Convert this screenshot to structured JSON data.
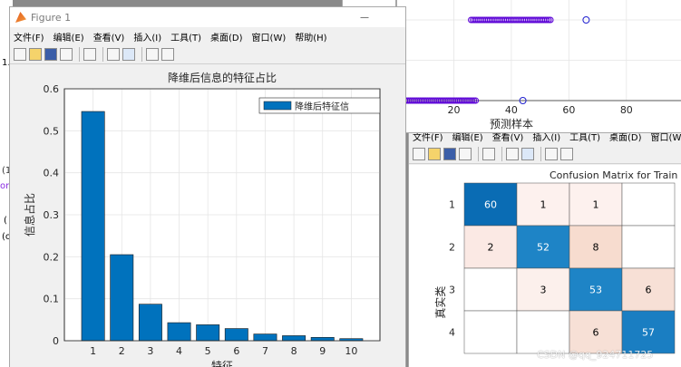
{
  "fig_left": {
    "title": "Figure 1",
    "menu": [
      "文件(F)",
      "编辑(E)",
      "查看(V)",
      "插入(I)",
      "工具(T)",
      "桌面(D)",
      "窗口(W)",
      "帮助(H)"
    ],
    "toolbar_icons": [
      "new-file-icon",
      "open-folder-icon",
      "save-icon",
      "print-icon",
      "print-preview-icon",
      "dock-icon",
      "legend-icon",
      "pointer-icon",
      "property-editor-icon"
    ],
    "minimize_label": "—"
  },
  "fig_top": {
    "xlabel": "预测样本"
  },
  "fig_right": {
    "menu": [
      "文件(F)",
      "编辑(E)",
      "查看(V)",
      "插入(I)",
      "工具(T)",
      "桌面(D)",
      "窗口(W)"
    ],
    "toolbar_icons": [
      "new-file-icon",
      "open-folder-icon",
      "save-icon",
      "print-icon",
      "print-preview-icon",
      "dock-icon",
      "legend-icon",
      "pointer-icon",
      "property-editor-icon"
    ]
  },
  "bg_fragments": {
    "left_one": "1.",
    "left_paren1": "(1",
    "left_or": "or",
    "left_paren2": "(",
    "left_paren3": "(o"
  },
  "watermark": "CSDN @qq_924711725",
  "chart_data": [
    {
      "type": "bar",
      "title": "降维后信息的特征占比",
      "xlabel": "特征",
      "ylabel": "信息占比",
      "categories": [
        "1",
        "2",
        "3",
        "4",
        "5",
        "6",
        "7",
        "8",
        "9",
        "10"
      ],
      "values": [
        0.546,
        0.205,
        0.087,
        0.043,
        0.038,
        0.029,
        0.016,
        0.012,
        0.008,
        0.005
      ],
      "ylim": [
        0,
        0.6
      ],
      "yticks": [
        "0",
        "0.1",
        "0.2",
        "0.3",
        "0.4",
        "0.5",
        "0.6"
      ],
      "legend": "降维后特征信",
      "legend_placement": "top-right",
      "grid": true,
      "color": "#0072BD"
    },
    {
      "type": "scatter",
      "xlabel": "预测样本",
      "xlim": [
        0,
        110
      ],
      "ylim": [
        1,
        2
      ],
      "xticks": [
        "0",
        "20",
        "40",
        "60",
        "80",
        "100"
      ],
      "yticks": [
        "1",
        "1.5",
        "2"
      ],
      "grid": true,
      "series": [
        {
          "marker": "o",
          "color": "#5a00d6",
          "x": [
            0,
            28
          ],
          "y": 1,
          "dense": true
        },
        {
          "marker": "o",
          "color": "#5a00d6",
          "x": [
            26,
            54
          ],
          "y": 2,
          "dense": true
        },
        {
          "marker": "o",
          "color": "#1f1fcf",
          "points": [
            [
              44,
              1
            ],
            [
              66,
              2
            ]
          ]
        }
      ]
    },
    {
      "type": "heatmap",
      "title": "Confusion Matrix for Train D",
      "ylabel": "真实类",
      "row_labels": [
        "1",
        "2",
        "3",
        "4"
      ],
      "cells": [
        [
          "60",
          "1",
          "1",
          ""
        ],
        [
          "2",
          "52",
          "8",
          ""
        ],
        [
          "",
          "3",
          "53",
          "6"
        ],
        [
          "",
          "",
          "6",
          "57"
        ]
      ],
      "colors": [
        [
          "#0a6cb4",
          "#fdf1ee",
          "#fdf1ee",
          "#ffffff"
        ],
        [
          "#fbe9e4",
          "#1e84c6",
          "#f7dccf",
          "#ffffff"
        ],
        [
          "#ffffff",
          "#fcf0ec",
          "#1e84c6",
          "#f7e0d6"
        ],
        [
          "#ffffff",
          "#ffffff",
          "#f7e0d6",
          "#1a7ec2"
        ]
      ],
      "text_colors": [
        [
          "#ffffff",
          "#000000",
          "#000000",
          "#000000"
        ],
        [
          "#000000",
          "#ffffff",
          "#000000",
          "#000000"
        ],
        [
          "#000000",
          "#000000",
          "#ffffff",
          "#000000"
        ],
        [
          "#000000",
          "#000000",
          "#000000",
          "#ffffff"
        ]
      ]
    }
  ]
}
